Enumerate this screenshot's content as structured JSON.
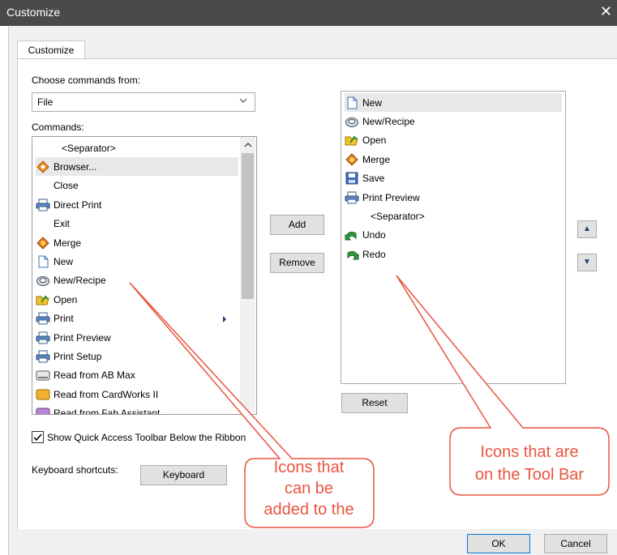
{
  "window": {
    "title": "Customize",
    "close_glyph": "✕"
  },
  "tab": {
    "label": "Customize"
  },
  "choose_label": "Choose commands from:",
  "choose_value": "File",
  "commands_label": "Commands:",
  "commands": [
    {
      "label": "<Separator>",
      "icon": "none"
    },
    {
      "label": "Browser...",
      "icon": "browser-icon"
    },
    {
      "label": "Close",
      "icon": "none"
    },
    {
      "label": "Direct Print",
      "icon": "printer-icon"
    },
    {
      "label": "Exit",
      "icon": "none"
    },
    {
      "label": "Merge",
      "icon": "merge-icon"
    },
    {
      "label": "New",
      "icon": "new-document-icon"
    },
    {
      "label": "New/Recipe",
      "icon": "recipe-icon"
    },
    {
      "label": "Open",
      "icon": "open-icon"
    },
    {
      "label": "Print",
      "icon": "printer-icon"
    },
    {
      "label": "Print Preview",
      "icon": "printer-icon"
    },
    {
      "label": "Print Setup",
      "icon": "printer-icon"
    },
    {
      "label": "Read from AB Max",
      "icon": "reader-icon"
    },
    {
      "label": "Read from CardWorks II",
      "icon": "cardworks-icon"
    },
    {
      "label": "Read from Fab Assistant",
      "icon": "fab-icon"
    }
  ],
  "toolbar_items": [
    {
      "label": "New",
      "icon": "new-document-icon"
    },
    {
      "label": "New/Recipe",
      "icon": "recipe-icon"
    },
    {
      "label": "Open",
      "icon": "open-icon"
    },
    {
      "label": "Merge",
      "icon": "merge-icon"
    },
    {
      "label": "Save",
      "icon": "save-icon"
    },
    {
      "label": "Print Preview",
      "icon": "printer-icon"
    },
    {
      "label": "<Separator>",
      "icon": "none"
    },
    {
      "label": "Undo",
      "icon": "undo-icon"
    },
    {
      "label": "Redo",
      "icon": "redo-icon"
    }
  ],
  "buttons": {
    "add": "Add",
    "remove": "Remove",
    "reset": "Reset",
    "keyboard": "Keyboard",
    "ok": "OK",
    "cancel": "Cancel",
    "move_up": "▲",
    "move_down": "▼"
  },
  "checkbox": {
    "label": "Show Quick Access Toolbar Below the Ribbon",
    "checked": true
  },
  "keyboard_label": "Keyboard shortcuts:",
  "callouts": {
    "left": [
      "Icons that",
      "can be",
      "added to the"
    ],
    "right": [
      "Icons that are",
      "on the Tool Bar"
    ]
  },
  "colors": {
    "accent": "#0078d7",
    "callout": "#e8553f"
  }
}
